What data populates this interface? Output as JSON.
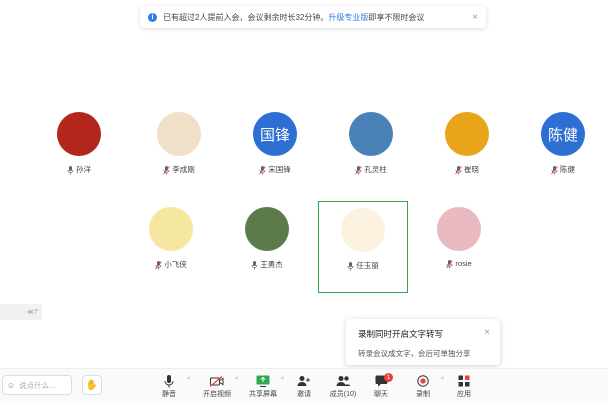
{
  "notice": {
    "text": "已有超过2人提前入会，会议剩余时长32分钟。",
    "link": "升级专业版",
    "suffix": "即享不限时会议",
    "close": "×"
  },
  "participants": [
    {
      "name": "孙洋",
      "avatar_text": "",
      "mic": "on",
      "bg": "#b3261e"
    },
    {
      "name": "李成刚",
      "avatar_text": "",
      "mic": "off",
      "bg": "#f0e0c8"
    },
    {
      "name": "宋国锋",
      "avatar_text": "国锋",
      "mic": "off",
      "bg": "#2d6fd2"
    },
    {
      "name": "孔灵柱",
      "avatar_text": "",
      "mic": "off",
      "bg": "#4a82b8"
    },
    {
      "name": "崔晓",
      "avatar_text": "",
      "mic": "off",
      "bg": "#e8a51a"
    },
    {
      "name": "陈健",
      "avatar_text": "陈健",
      "mic": "off",
      "bg": "#2d6fd2"
    },
    {
      "name": "小飞侠",
      "avatar_text": "",
      "mic": "off",
      "bg": "#f5e6a0"
    },
    {
      "name": "王勇杰",
      "avatar_text": "",
      "mic": "on",
      "bg": "#5d7a4a"
    },
    {
      "name": "任玉丽",
      "avatar_text": "",
      "mic": "on",
      "bg": "#fbf2df"
    },
    {
      "name": "rosie",
      "avatar_text": "",
      "mic": "off",
      "bg": "#e9b9c2"
    }
  ],
  "side_tab": "≪7",
  "tip": {
    "title": "录制同时开启文字转写",
    "body": "转录会议成文字，会后可单独分享",
    "close": "×"
  },
  "toolbar": {
    "chat_placeholder": "说点什么...",
    "chat_icon": "☺",
    "hand_icon": "✋",
    "buttons": [
      {
        "label": "静音",
        "icon": "mic-icon"
      },
      {
        "label": "开启视频",
        "icon": "camera-off-icon"
      },
      {
        "label": "共享屏幕",
        "icon": "share-screen-icon"
      },
      {
        "label": "邀请",
        "icon": "invite-icon"
      },
      {
        "label": "成员(10)",
        "icon": "members-icon"
      },
      {
        "label": "聊天",
        "icon": "chat-icon",
        "badge": "1"
      },
      {
        "label": "录制",
        "icon": "record-icon"
      },
      {
        "label": "应用",
        "icon": "apps-icon"
      }
    ]
  },
  "colors": {
    "accent": "#2f7de1",
    "active_border": "#2fa84f",
    "muted_mic": "#e0443b"
  }
}
